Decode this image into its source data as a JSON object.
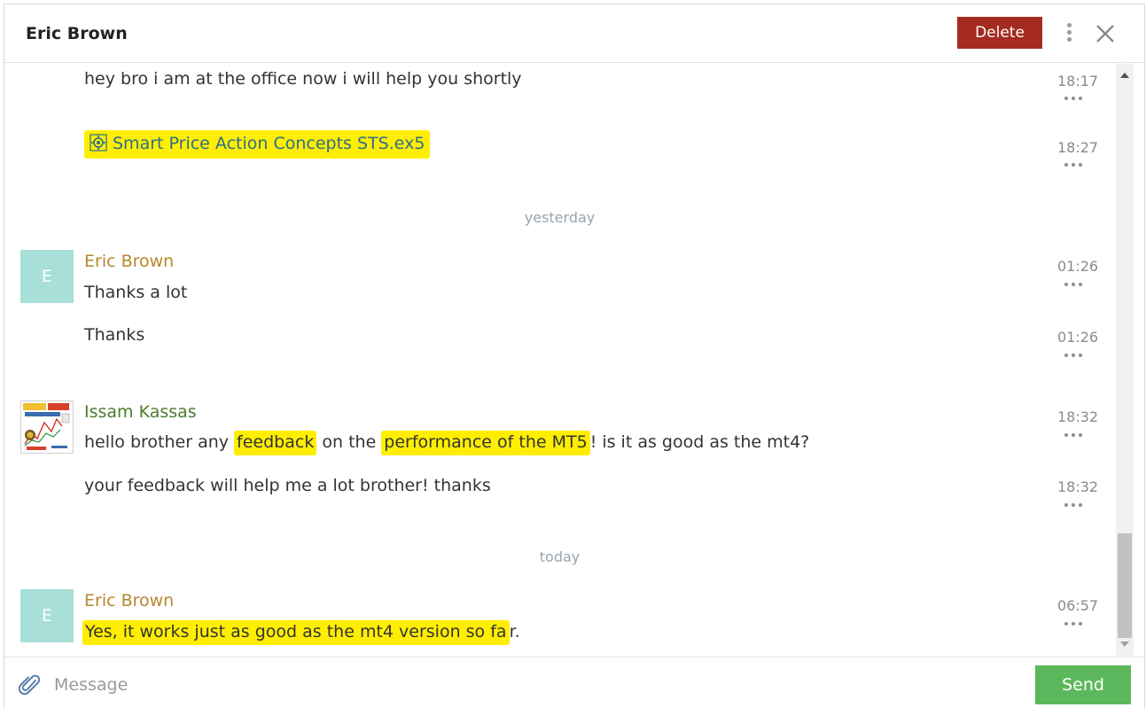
{
  "header": {
    "title": "Eric Brown",
    "delete_label": "Delete"
  },
  "messages": [
    {
      "text": "hey bro i am at the office now i will help you shortly",
      "time": "18:17"
    },
    {
      "file_name": "Smart Price Action Concepts STS.ex5",
      "time": "18:27"
    },
    {
      "divider": "yesterday"
    },
    {
      "sender": "Eric Brown",
      "avatar_letter": "E",
      "text": "Thanks a lot",
      "time": "01:26"
    },
    {
      "text": "Thanks",
      "time": "01:26"
    },
    {
      "sender": "Issam Kassas",
      "text_parts": [
        "hello brother any ",
        "feedback",
        " on the ",
        "performance of the MT5",
        "! is it as good as the mt4?"
      ],
      "time": "18:32"
    },
    {
      "text": "your feedback will help me a lot brother! thanks",
      "time": "18:32"
    },
    {
      "divider": "today"
    },
    {
      "sender": "Eric Brown",
      "avatar_letter": "E",
      "text_parts": [
        "Yes, it works just as good as the mt4 version so fa",
        "r."
      ],
      "time": "06:57"
    }
  ],
  "composer": {
    "placeholder": "Message",
    "send_label": "Send"
  },
  "colors": {
    "delete": "#a52a1f",
    "send": "#5cb85c",
    "highlight": "#ffee00",
    "sender_eric": "#b8862c",
    "sender_issam": "#4b7d2b",
    "avatar_bg": "#a8dfd8"
  },
  "icons": {
    "file": "gear-file-icon",
    "attach": "paperclip-icon",
    "menu": "kebab-menu-icon",
    "close": "close-icon",
    "message_menu": "more-horizontal-icon"
  }
}
